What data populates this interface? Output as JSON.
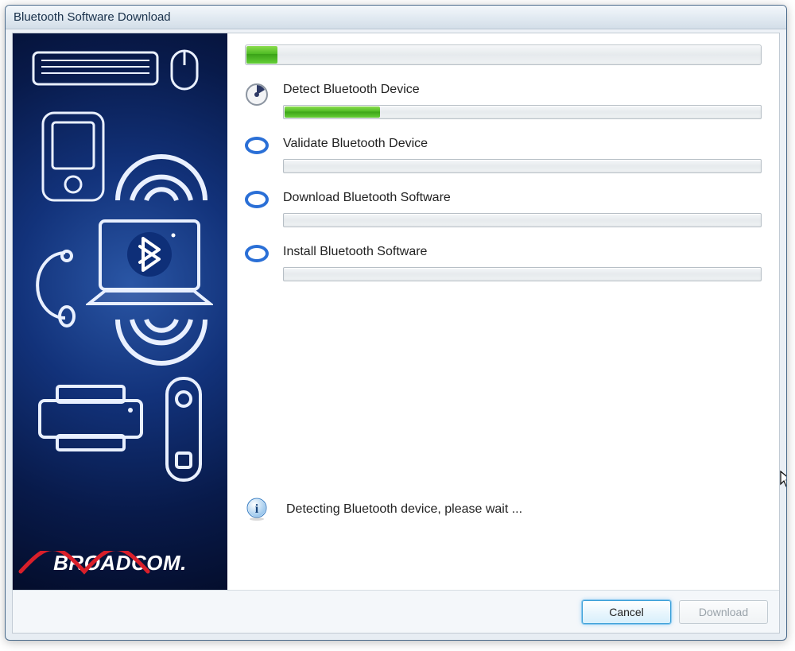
{
  "window": {
    "title": "Bluetooth Software Download"
  },
  "overall_progress_percent": 6,
  "steps": [
    {
      "label": "Detect Bluetooth Device",
      "state": "active",
      "progress_percent": 20
    },
    {
      "label": "Validate Bluetooth Device",
      "state": "pending",
      "progress_percent": 0
    },
    {
      "label": "Download Bluetooth Software",
      "state": "pending",
      "progress_percent": 0
    },
    {
      "label": "Install Bluetooth Software",
      "state": "pending",
      "progress_percent": 0
    }
  ],
  "status": {
    "message": "Detecting Bluetooth device, please wait ..."
  },
  "buttons": {
    "cancel": {
      "label": "Cancel",
      "enabled": true
    },
    "download": {
      "label": "Download",
      "enabled": false
    }
  },
  "brand": "BROADCOM."
}
